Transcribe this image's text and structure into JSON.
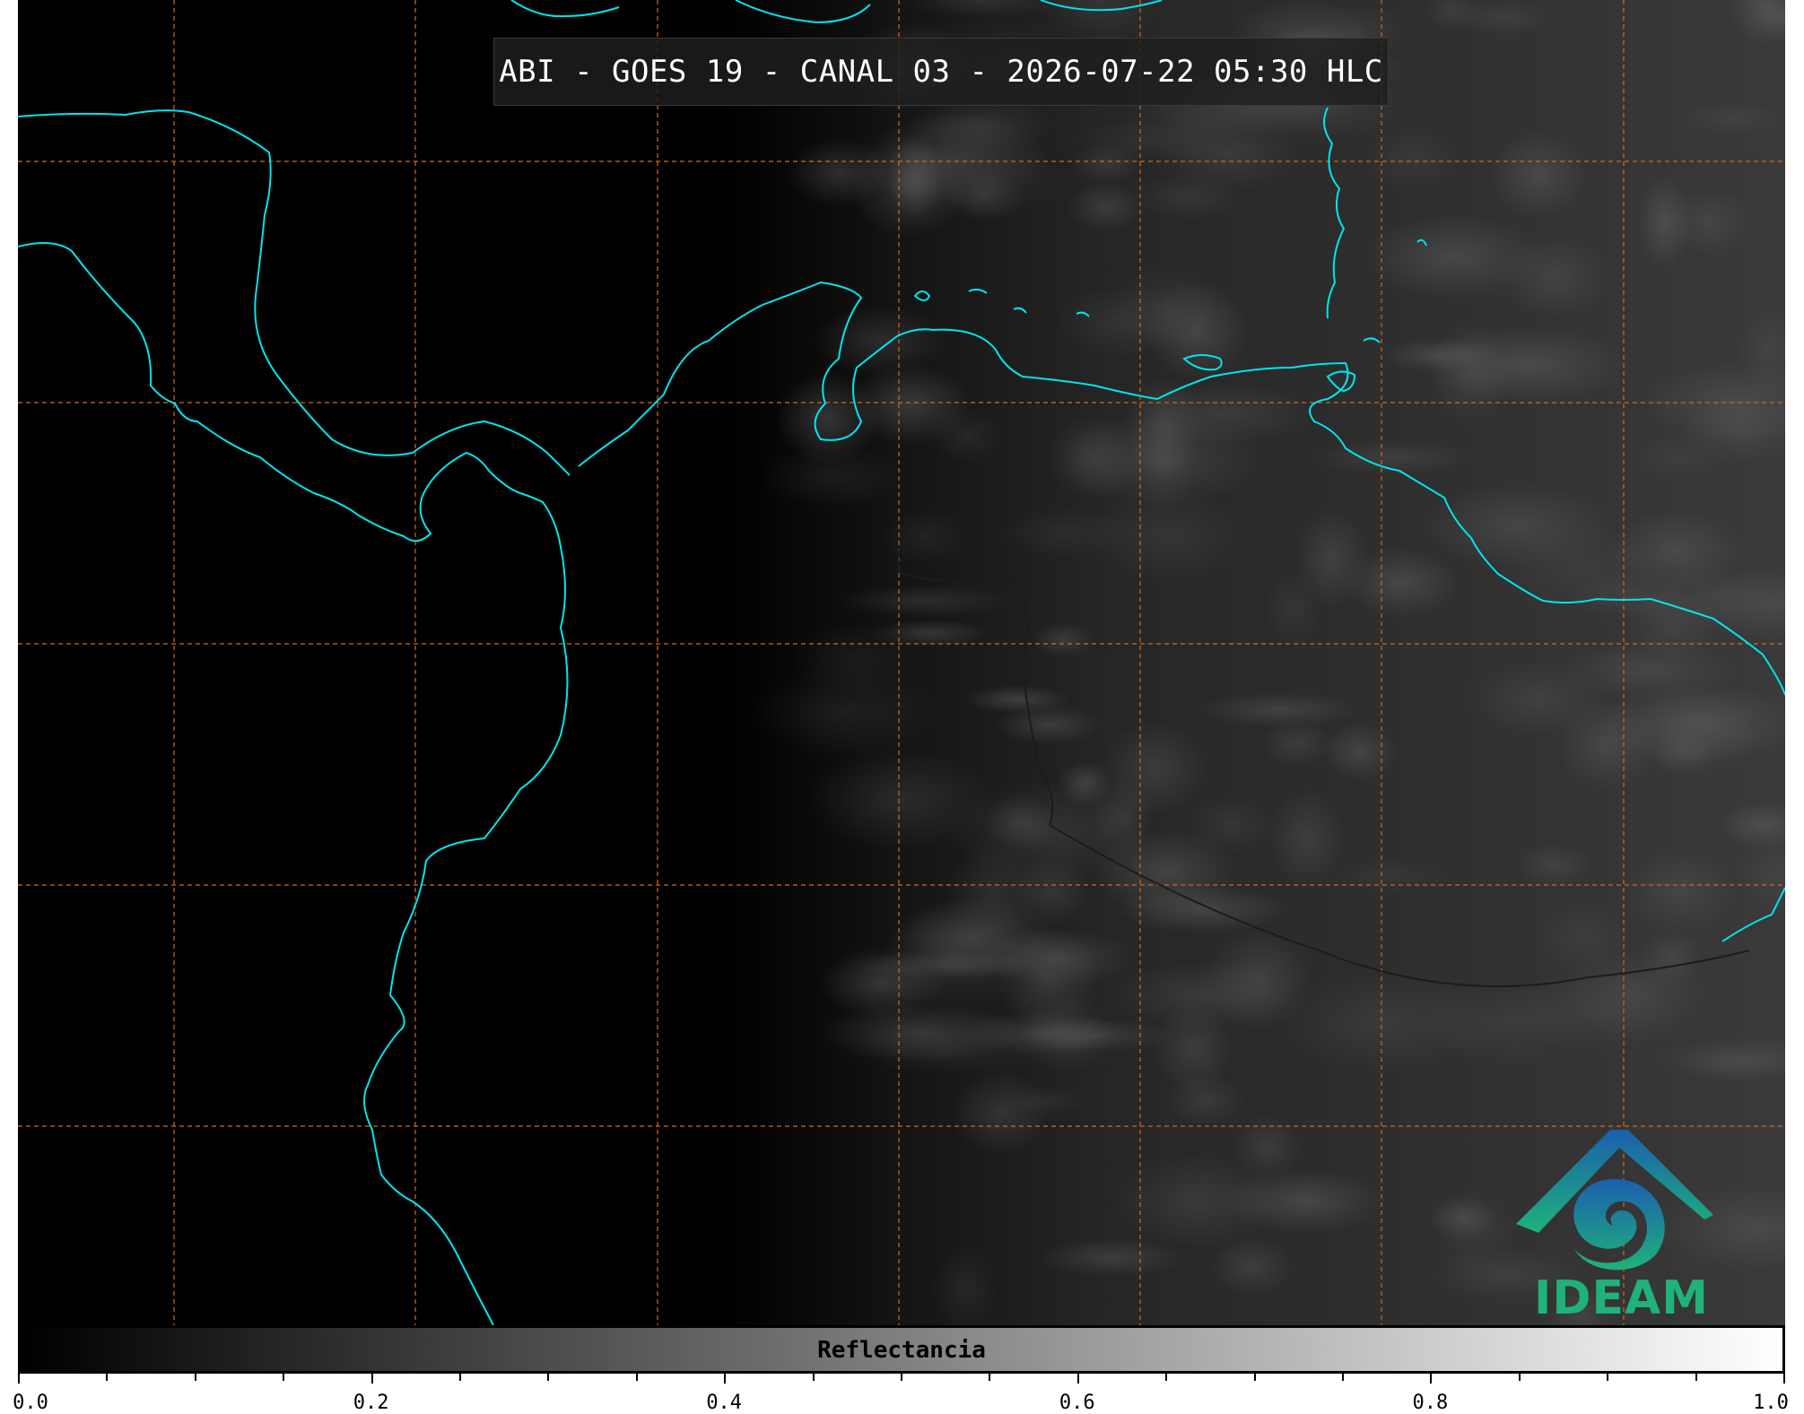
{
  "title": "ABI - GOES 19 - CANAL 03 - 2026-07-22 05:30 HLC",
  "logo": {
    "text": "IDEAM",
    "icon": "ideam-logo-icon",
    "color": "#1fb27a"
  },
  "colorbar": {
    "label": "Reflectancia",
    "range": [
      0.0,
      1.0
    ],
    "colormap": [
      "#000000",
      "#ffffff"
    ],
    "major_ticks": [
      "0.0",
      "0.2",
      "0.4",
      "0.6",
      "0.8",
      "1.0"
    ],
    "minor_tick_step": 0.05
  },
  "map": {
    "coastline_color": "#00e5ee",
    "border_color": "#222222",
    "gridline_color": "#d2691e",
    "gridline_style": "dashed",
    "background": "#000000"
  }
}
